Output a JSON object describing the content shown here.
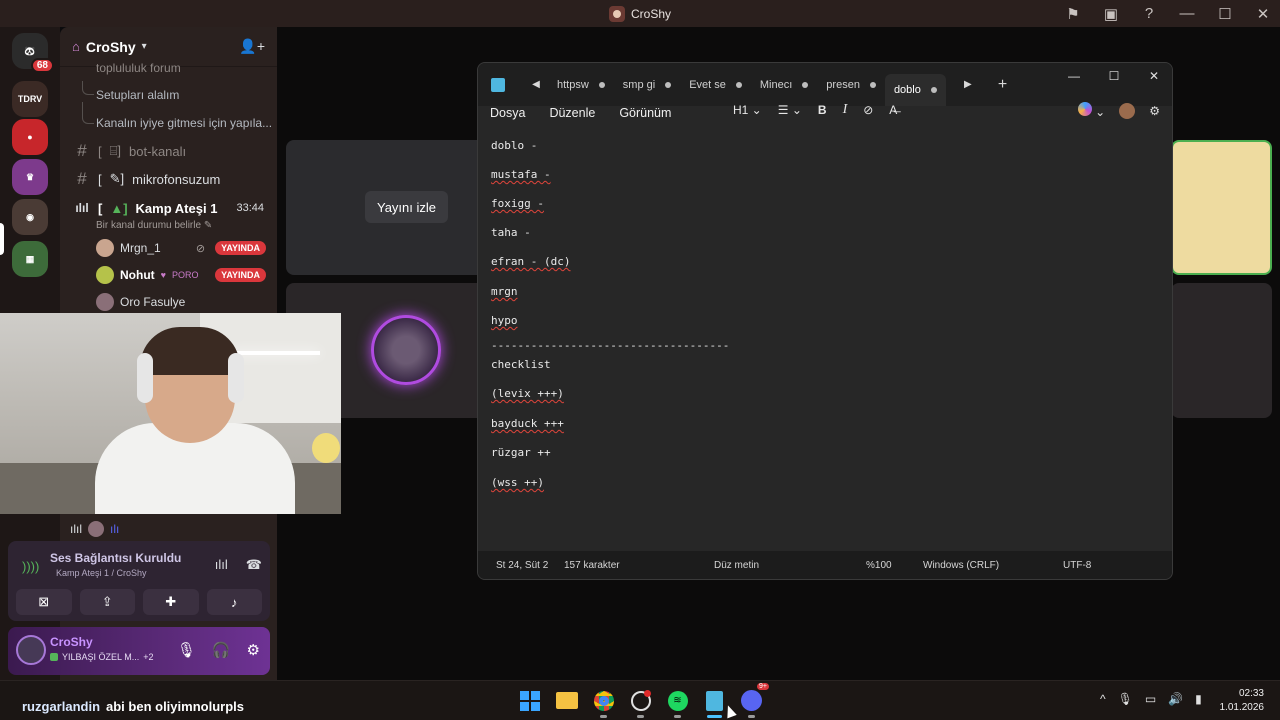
{
  "window": {
    "title": "CroShy"
  },
  "server": {
    "name": "CroShy",
    "threads": [
      "toplululuk forum",
      "Setupları alalım",
      "Kanalın iyiye gitmesi için yapıla..."
    ],
    "channels": [
      {
        "prefix": "[",
        "name": "bot-kanalı"
      },
      {
        "prefix": "[",
        "name": "mikrofonsuzum"
      }
    ],
    "voice_channel": {
      "prefix": "[",
      "name": "Kamp Ateşi 1",
      "timer": "33:44",
      "status": "Bir kanal durumu belirle"
    },
    "voice_users": [
      {
        "name": "Mrgn_1",
        "badge": "YAYINDA"
      },
      {
        "name": "Nohut",
        "tag": "PORO",
        "badge": "YAYINDA"
      },
      {
        "name": "Oro Fasulye"
      }
    ]
  },
  "rail": {
    "badge": "68"
  },
  "voice_panel": {
    "status": "Ses Bağlantısı Kuruldu",
    "channel": "Kamp Ateşi 1 / CroShy"
  },
  "user": {
    "name": "CroShy",
    "status": "YILBAŞI ÖZEL M...",
    "extra": "+2"
  },
  "stream": {
    "watch_label": "Yayını izle"
  },
  "notepad": {
    "tabs": [
      "httpsw",
      "smp gi",
      "Evet se",
      "Minecı",
      "presen",
      "doblo"
    ],
    "menu": [
      "Dosya",
      "Düzenle",
      "Görünüm"
    ],
    "heading_select": "H1",
    "lines": [
      "doblo -",
      "mustafa -",
      "foxigg -",
      "taha -",
      "efran - (dc)",
      "mrgn",
      "hypo",
      "------------------------------------",
      "checklist",
      "(levix +++)",
      "bayduck +++",
      "rüzgar ++",
      "(wss ++)"
    ],
    "status": {
      "position": "St 24, Süt 2",
      "chars": "157 karakter",
      "format": "Düz metin",
      "zoom": "%100",
      "eol": "Windows (CRLF)",
      "encoding": "UTF-8"
    }
  },
  "chat_overlay": {
    "user": "ruzgarlandin",
    "message": "abi ben oliyimnolurpls"
  },
  "taskbar": {
    "time": "02:33",
    "date": "1.01.2026",
    "discord_badge": "9+"
  }
}
